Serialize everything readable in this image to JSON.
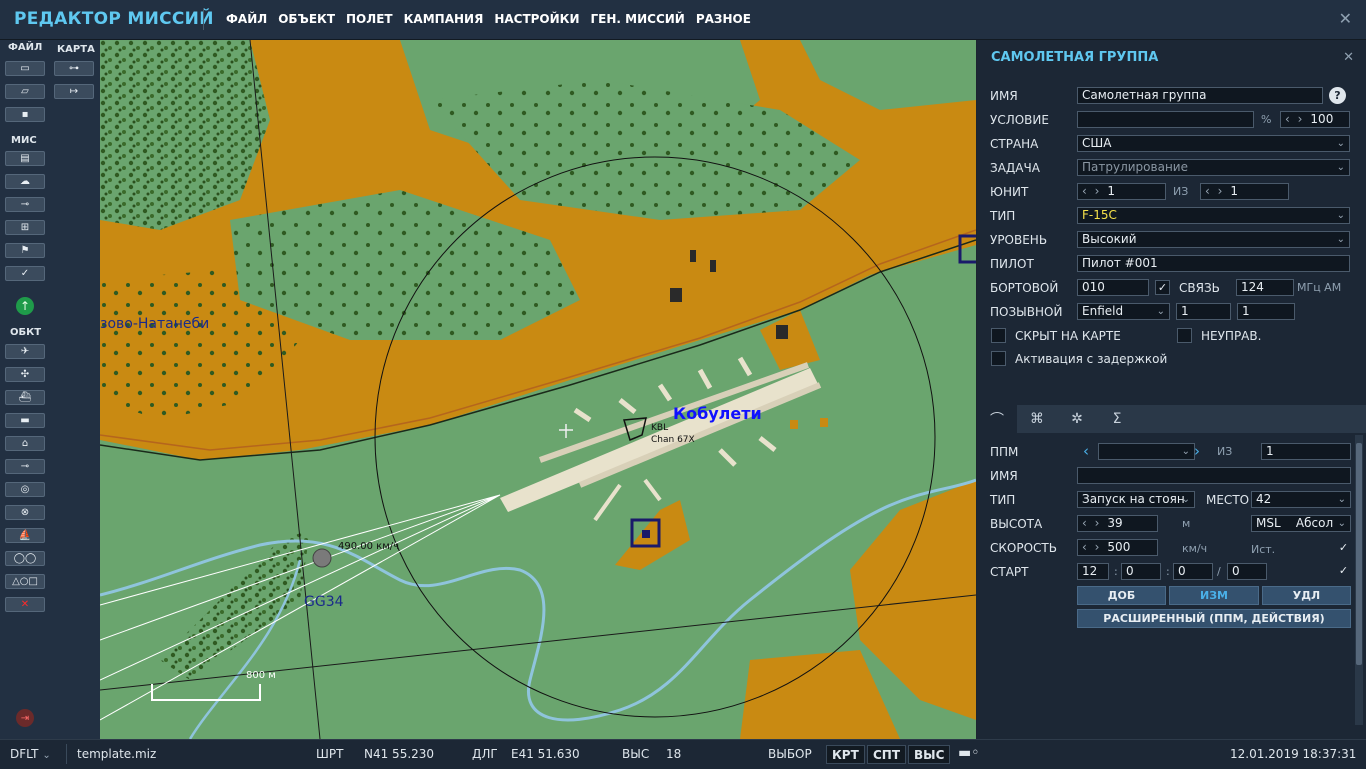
{
  "app": {
    "title": "РЕДАКТОР МИССИЙ",
    "menu": [
      "ФАЙЛ",
      "ОБЪЕКТ",
      "ПОЛЕТ",
      "КАМПАНИЯ",
      "НАСТРОЙКИ",
      "ГЕН. МИССИЙ",
      "РАЗНОЕ"
    ],
    "close_glyph": "✕"
  },
  "left_toolbar": {
    "file_label": "ФАЙЛ",
    "map_label": "КАРТА",
    "mission_label": "МИС",
    "objects_label": "ОБКТ"
  },
  "map": {
    "town_label": "зово-Натанеби",
    "airfield_name": "Кобулети",
    "airfield_code": "KBL",
    "airfield_channel": "Chan 67X",
    "speed_label": "490.00 км/ч",
    "group_label": "GG34",
    "scale_label": "800 м",
    "colors": {
      "grass": "#6aa56e",
      "field": "#c98a12",
      "forest": "#2f5a21",
      "river": "#8fc4dc",
      "airfield_label": "#1010ff",
      "group_label": "#1a2a8a"
    }
  },
  "panel": {
    "title": "САМОЛЕТНАЯ ГРУППА",
    "labels": {
      "name": "ИМЯ",
      "condition": "УСЛОВИЕ",
      "country": "СТРАНА",
      "task": "ЗАДАЧА",
      "unit": "ЮНИТ",
      "of": "ИЗ",
      "type": "ТИП",
      "skill": "УРОВЕНЬ",
      "pilot": "ПИЛОТ",
      "tail": "БОРТОВОЙ",
      "comm": "СВЯЗЬ",
      "callsign": "ПОЗЫВНОЙ",
      "hidden": "СКРЫТ НА КАРТЕ",
      "uncontrolled": "НЕУПРАВ.",
      "late_activation": "Активация с задержкой",
      "percent": "%",
      "mhz": "МГц AM"
    },
    "values": {
      "name": "Самолетная группа",
      "condition": "",
      "probability": "100",
      "country": "США",
      "task": "Патрулирование",
      "unit": "1",
      "unit_of": "1",
      "type": "F-15C",
      "skill": "Высокий",
      "pilot": "Пилот #001",
      "tail": "010",
      "freq": "124",
      "callsign": "Enfield",
      "callsign_n1": "1",
      "callsign_n2": "1"
    },
    "help": "?"
  },
  "waypoint": {
    "labels": {
      "wpt": "ППМ",
      "of": "ИЗ",
      "name": "ИМЯ",
      "type": "ТИП",
      "place": "МЕСТО",
      "alt": "ВЫСОТА",
      "alt_unit": "м",
      "speed": "СКОРОСТЬ",
      "speed_unit": "км/ч",
      "est": "Ист.",
      "start": "СТАРТ"
    },
    "values": {
      "wpt": "",
      "wpt_of": "1",
      "name": "",
      "type": "Запуск на стоян",
      "place": "42",
      "alt": "39",
      "alt_ref": "MSL",
      "alt_type": "Абсол",
      "speed": "500",
      "start_d": "12",
      "start_h": "0",
      "start_m": "0",
      "start_s": "0"
    },
    "buttons": {
      "add": "ДОБ",
      "edit": "ИЗМ",
      "del": "УДЛ",
      "advanced": "РАСШИРЕННЫЙ (ППМ, ДЕЙСТВИЯ)"
    }
  },
  "status": {
    "profile": "DFLT",
    "file": "template.miz",
    "lat_label": "ШРТ",
    "lat": "N41 55.230",
    "lon_label": "ДЛГ",
    "lon": "E41 51.630",
    "alt_label": "ВЫС",
    "alt": "18",
    "select_label": "ВЫБОР",
    "krt": "КРТ",
    "spt": "СПТ",
    "vys": "ВЫС",
    "datetime": "12.01.2019 18:37:31"
  }
}
